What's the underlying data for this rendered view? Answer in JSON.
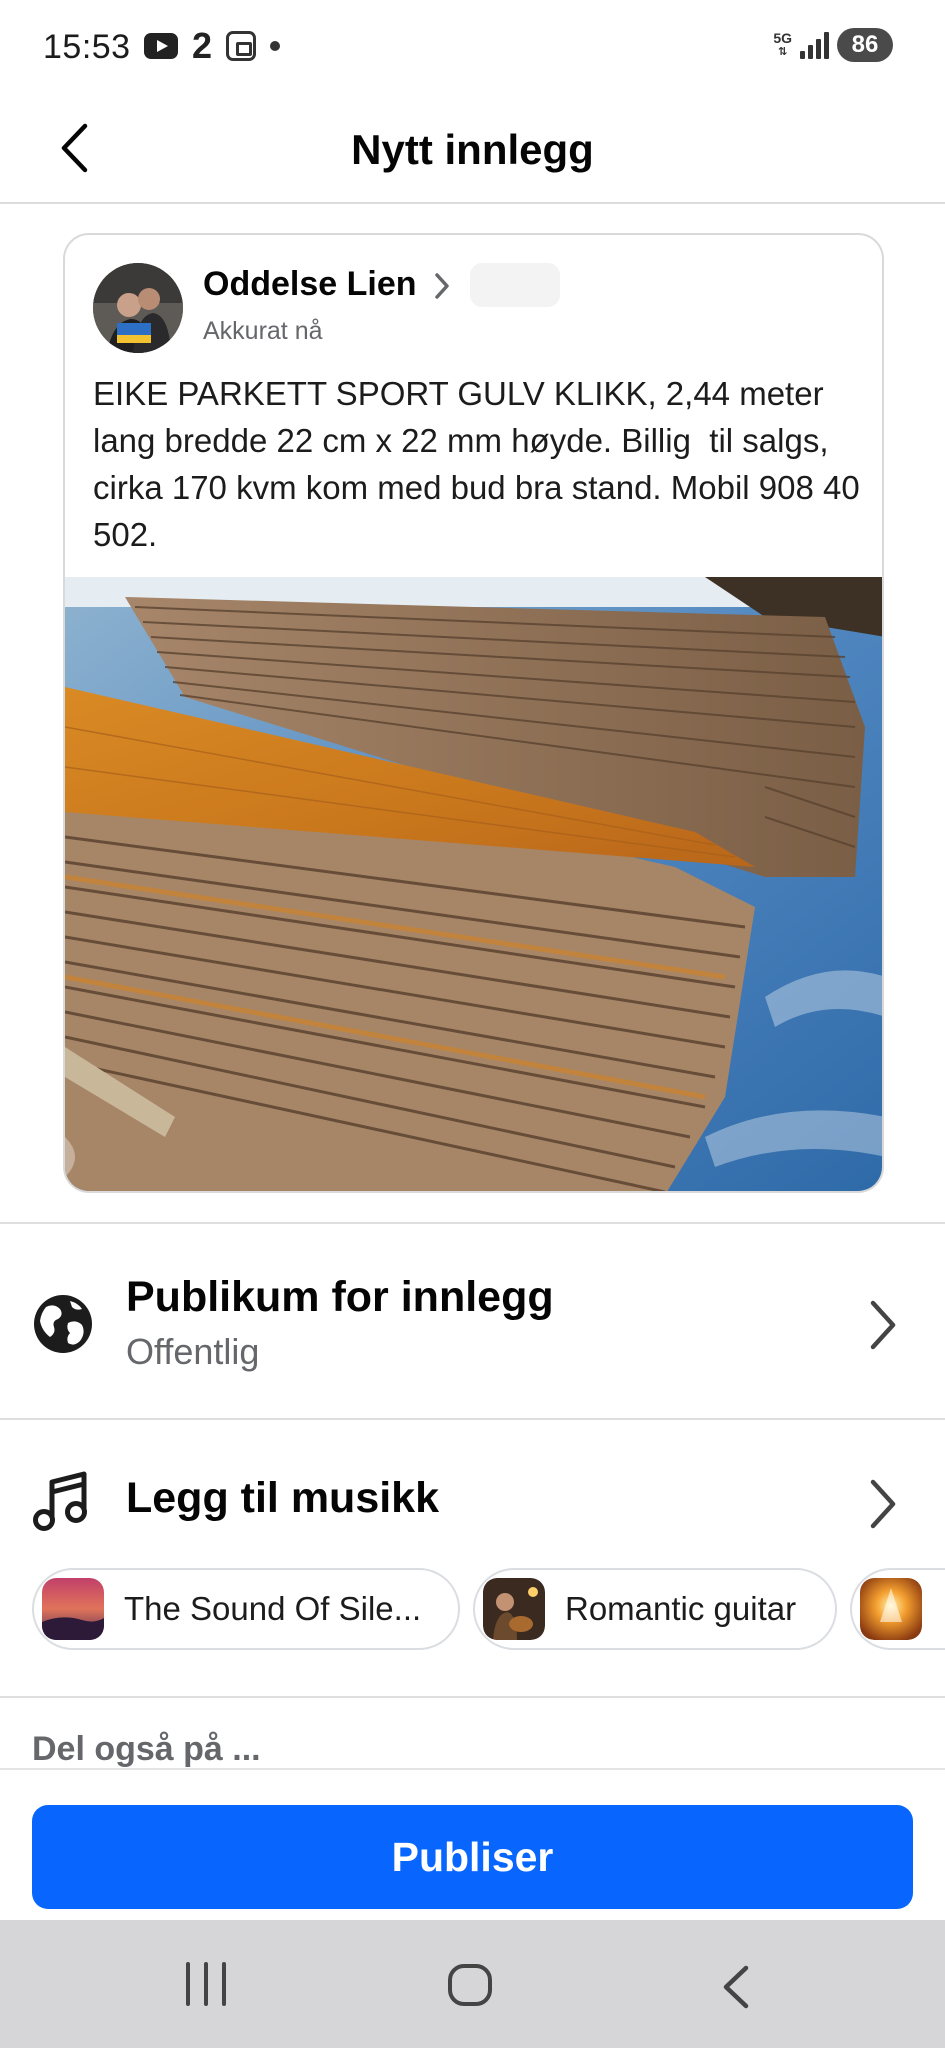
{
  "status_bar": {
    "time": "15:53",
    "notification_count": "2",
    "network": "5G",
    "battery": "86",
    "icons": [
      "youtube-icon",
      "screenshot-icon",
      "dot-icon",
      "signal-icon",
      "battery-icon"
    ]
  },
  "header": {
    "title": "Nytt innlegg",
    "back_icon": "chevron-left-icon"
  },
  "post": {
    "author": "Oddelse Lien",
    "time": "Akkurat nå",
    "text": "EIKE PARKETT SPORT GULV KLIKK, 2,44 meter lang bredde 22 cm x 22 mm høyde. Billig  til salgs, cirka 170 kvm kom med bud bra stand. Mobil 908 40 502."
  },
  "audience": {
    "title": "Publikum for innlegg",
    "value": "Offentlig",
    "icon": "globe-icon"
  },
  "music": {
    "title": "Legg til musikk",
    "icon": "music-note-icon",
    "suggestions": [
      {
        "label": "The Sound Of Sile..."
      },
      {
        "label": "Romantic guitar"
      },
      {
        "label": ""
      }
    ]
  },
  "share_also": "Del også på ...",
  "publish_button": "Publiser",
  "colors": {
    "primary": "#0866ff",
    "secondary_text": "#65676b",
    "divider": "#dedede"
  }
}
